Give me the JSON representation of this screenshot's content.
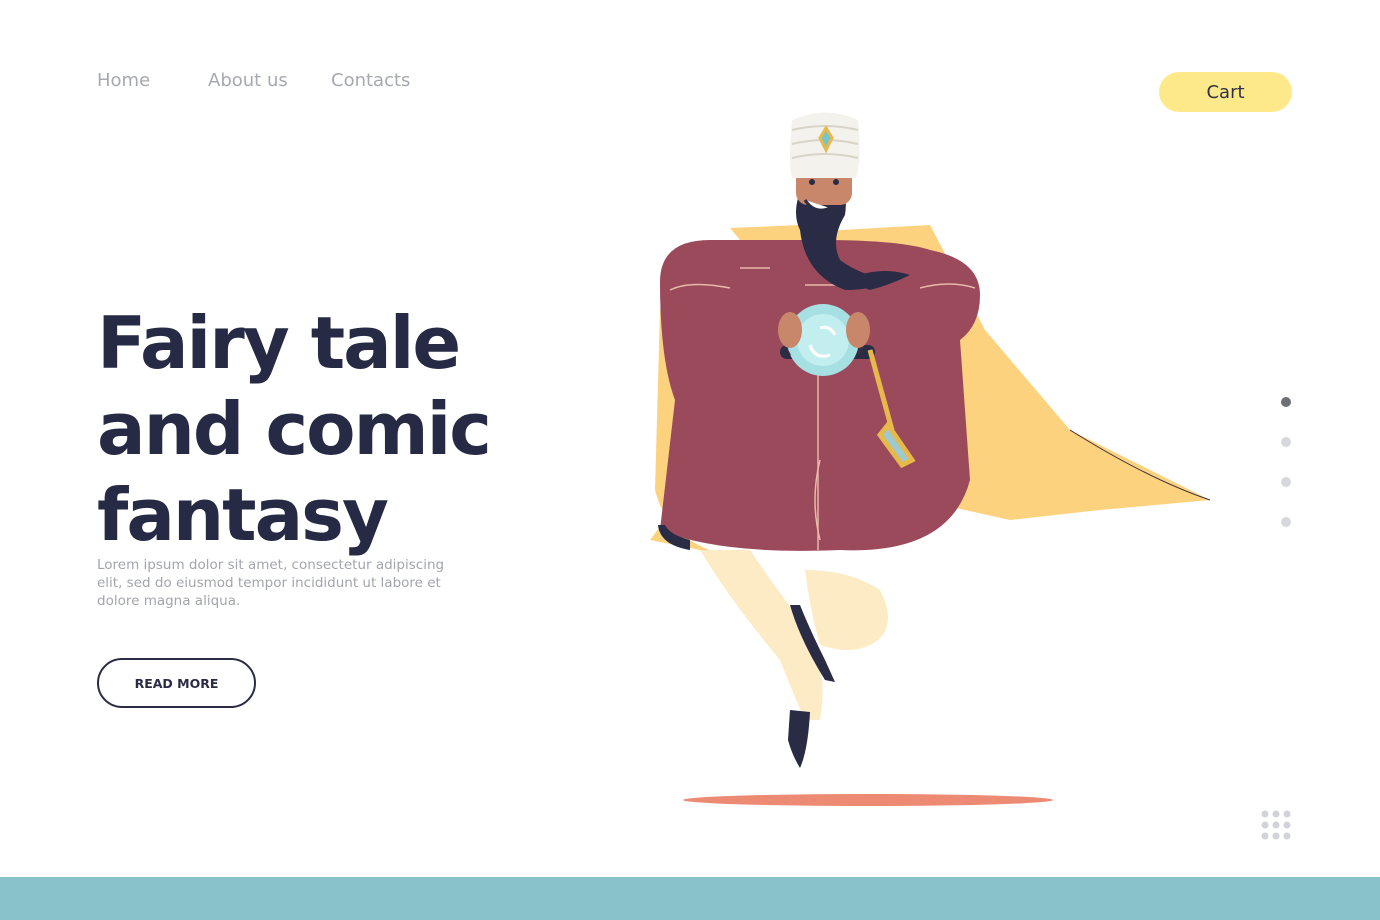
{
  "nav": {
    "items": [
      {
        "label": "Home"
      },
      {
        "label": "About us"
      },
      {
        "label": "Contacts"
      }
    ]
  },
  "header": {
    "cart_label": "Cart"
  },
  "hero": {
    "title_lines": [
      "Fairy tale",
      "and comic",
      "fantasy"
    ],
    "body": "Lorem ipsum dolor sit amet, consectetur adipiscing elit, sed do eiusmod tempor incididunt ut labore et dolore magna aliqua.",
    "cta_label": "READ MORE"
  },
  "slider": {
    "total": 4,
    "active_index": 0
  },
  "colors": {
    "accent_yellow": "#fde98a",
    "text_dark": "#262a44",
    "footer_teal": "#89c2cb",
    "robe": "#9b4a5c",
    "cape": "#fdd27f",
    "shadow": "#ec8a73"
  },
  "icons": {
    "grid": "grid-dots-icon",
    "character": "wizard-illustration"
  }
}
